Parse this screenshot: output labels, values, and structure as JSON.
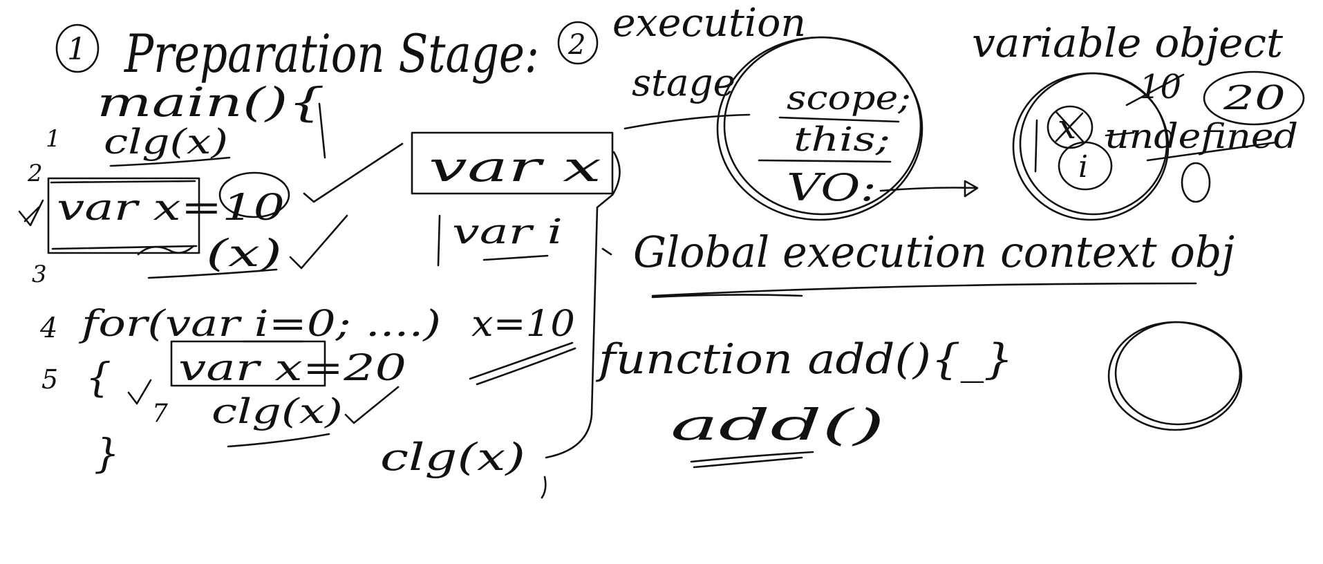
{
  "canvas": {
    "background": "#ffffff",
    "ink_color": "#111111"
  },
  "stage1": {
    "number": "1",
    "title": "Preparation Stage:",
    "main_open": "main(){",
    "line_numbers": [
      "1",
      "2",
      "3",
      "4",
      "5",
      "7"
    ],
    "code": {
      "clg_x_first": "clg(x)",
      "var_x_10": "var x=10",
      "clg_x_second": "(x)",
      "for_loop": "for(var i=0; ....)",
      "block_open": "{",
      "var_x_20": "var x=20",
      "clg_x_third": "clg(x)",
      "block_close": "}"
    },
    "right_column": {
      "var_x_box": "var x",
      "var_i": "var i",
      "assign_x_10": "x=10",
      "clg_x_end": "clg(x)"
    }
  },
  "stage2": {
    "number": "2",
    "title_line1": "execution",
    "title_line2": "stage"
  },
  "context_circle": {
    "lines": [
      "scope;",
      "this;",
      "VO:"
    ]
  },
  "variable_object": {
    "label": "variable object",
    "struck_value": "10",
    "value_20": "20",
    "undefined_text": "undefined",
    "x_mark": "x",
    "i_mark": "i"
  },
  "global_label": "Global execution context obj",
  "function_decl": "function add(){_}",
  "function_call": "add()"
}
